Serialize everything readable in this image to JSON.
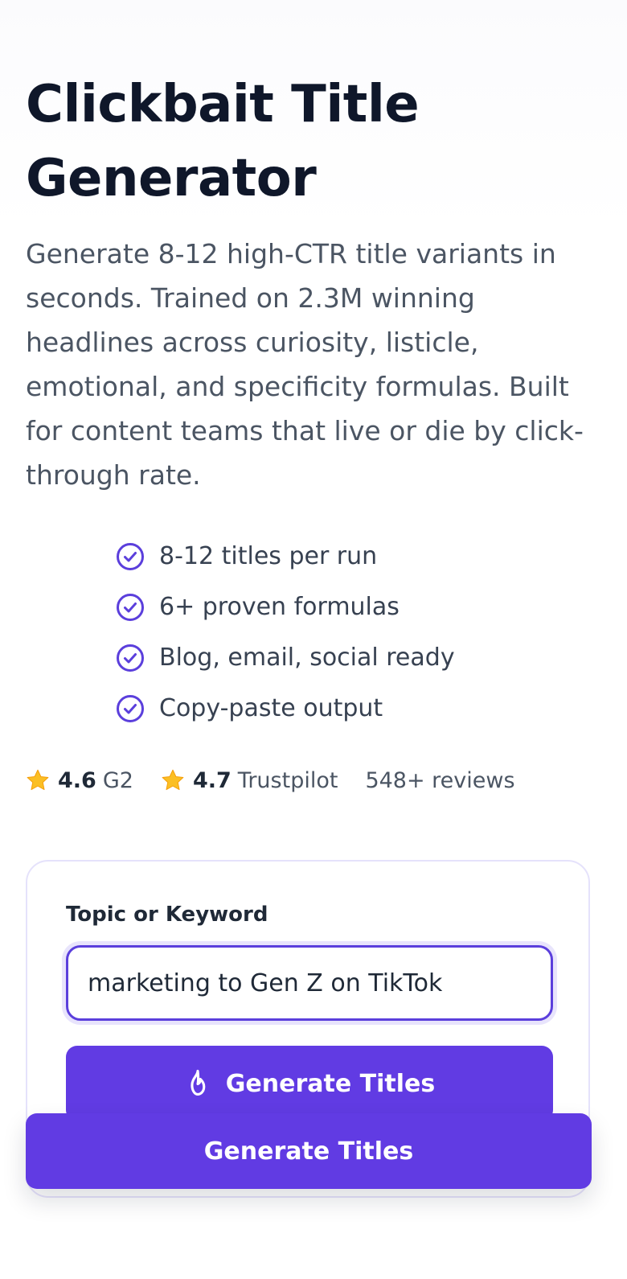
{
  "hero": {
    "title": "Clickbait Title Generator",
    "description": "Generate 8-12 high-CTR title variants in seconds. Trained on 2.3M winning headlines across curiosity, listicle, emotional, and specificity formulas. Built for content teams that live or die by click-through rate."
  },
  "features": [
    {
      "label": "8-12 titles per run",
      "icon": "check-circle-icon"
    },
    {
      "label": "6+ proven formulas",
      "icon": "check-circle-icon"
    },
    {
      "label": "Blog, email, social ready",
      "icon": "check-circle-icon"
    },
    {
      "label": "Copy-paste output",
      "icon": "check-circle-icon"
    }
  ],
  "ratings": [
    {
      "score": "4.6",
      "source": "G2",
      "icon": "star-icon"
    },
    {
      "score": "4.7",
      "source": "Trustpilot",
      "icon": "star-icon"
    }
  ],
  "reviews": "548+ reviews",
  "form": {
    "label": "Topic or Keyword",
    "value": "marketing to Gen Z on TikTok",
    "button_label": "Generate Titles",
    "button_icon": "flame-icon"
  },
  "sticky_cta": {
    "label": "Generate Titles"
  },
  "colors": {
    "accent": "#613be3",
    "check": "#5b3fdc",
    "star": "#fbbf24"
  }
}
